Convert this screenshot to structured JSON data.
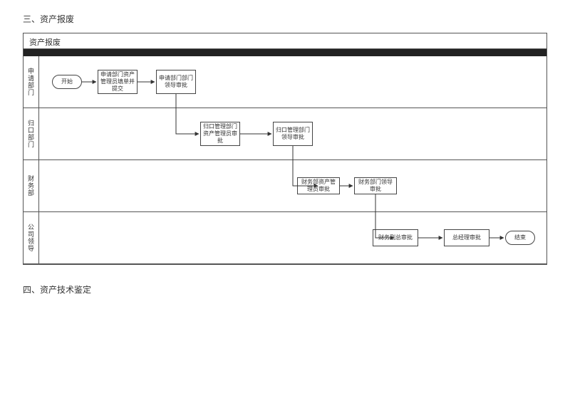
{
  "headings": {
    "section3": "三、资产报废",
    "section4": "四、资产技术鉴定"
  },
  "diagram": {
    "title": "资产报废",
    "lanes": [
      {
        "label": "申请部门"
      },
      {
        "label": "归口部门"
      },
      {
        "label": "财务部"
      },
      {
        "label": "公司领导"
      }
    ],
    "nodes": {
      "start": "开始",
      "n1": "申请部门资产管理员填单并提交",
      "n2": "申请部门部门领导审批",
      "n3": "归口管理部门资产管理员审批",
      "n4": "归口管理部门领导审批",
      "n5": "财务部资产管理员审批",
      "n6": "财务部门领导审批",
      "n7": "财务副总审批",
      "n8": "总经理审批",
      "end": "结束"
    }
  }
}
